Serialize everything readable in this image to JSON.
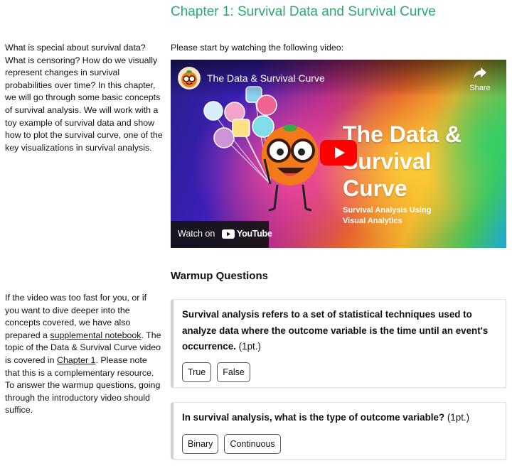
{
  "page": {
    "title": "Chapter 1: Survival Data and Survival Curve",
    "intro": "Please start by watching the following video:",
    "warmup_heading": "Warmup Questions"
  },
  "sidebar": {
    "top_text": "What is special about survival data? What is censoring? How do we visually represent changes in survival probabilities over time? In this chapter, we will go through some basic concepts of survival analysis. We will work with a toy example of survival data and show how to plot the survival curve, one of the key visualizations in survival analysis.",
    "bottom_text_1": "If the video was too fast for you, or if you want to dive deeper into the concepts covered, we have also prepared a ",
    "bottom_link_1": "supplemental notebook",
    "bottom_text_2": ". The topic of the Data & Survival Curve video is covered in ",
    "bottom_link_2": "Chapter 1",
    "bottom_text_3": ". Please note that this is a complementary resource. To answer the warmup questions, going through the introductory video should suffice."
  },
  "video": {
    "title": "The Data & Survival Curve",
    "share_label": "Share",
    "big_title_line1": "The Data &",
    "big_title_line2": "Survival",
    "big_title_line3": "Curve",
    "subtitle_line1": "Survival Analysis Using",
    "subtitle_line2": "Visual Analytics",
    "watch_on": "Watch on",
    "youtube_label": "YouTube",
    "icons": [
      "share-icon",
      "play-icon",
      "youtube-icon"
    ]
  },
  "questions": [
    {
      "text": "Survival analysis refers to a set of statistical techniques used to analyze data where the outcome variable is the time until an event's occurrence.",
      "points": "(1pt.)",
      "options": [
        "True",
        "False"
      ]
    },
    {
      "text": "In survival analysis, what is the type of outcome variable?",
      "points": "(1pt.)",
      "options": [
        "Binary",
        "Continuous"
      ]
    }
  ],
  "colors": {
    "title_green": "#2ba874",
    "youtube_red": "#ff0000"
  }
}
